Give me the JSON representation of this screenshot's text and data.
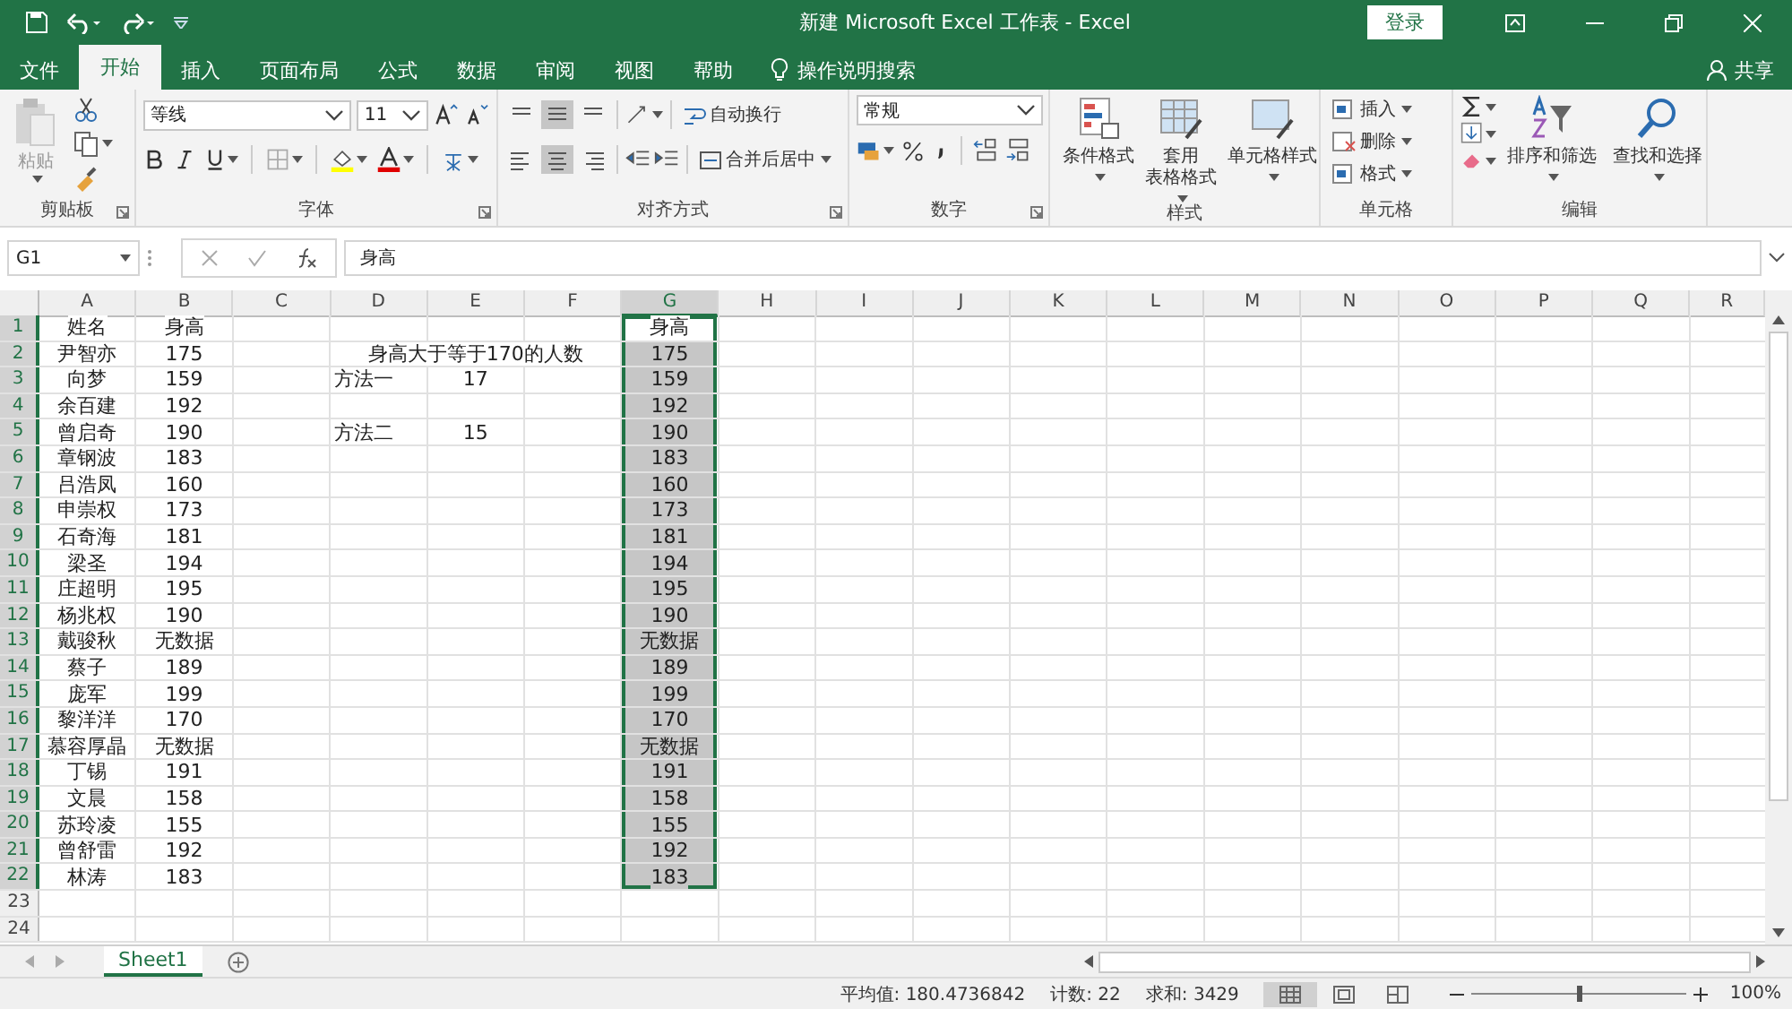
{
  "window": {
    "title": "新建 Microsoft Excel 工作表  -  Excel",
    "login": "登录"
  },
  "tabs": [
    {
      "label": "文件",
      "selected": false
    },
    {
      "label": "开始",
      "selected": true
    },
    {
      "label": "插入",
      "selected": false
    },
    {
      "label": "页面布局",
      "selected": false
    },
    {
      "label": "公式",
      "selected": false
    },
    {
      "label": "数据",
      "selected": false
    },
    {
      "label": "审阅",
      "selected": false
    },
    {
      "label": "视图",
      "selected": false
    },
    {
      "label": "帮助",
      "selected": false
    }
  ],
  "tell_me": {
    "placeholder": "操作说明搜索"
  },
  "share": "共享",
  "ribbon": {
    "clipboard": {
      "label": "剪贴板",
      "paste": "粘贴"
    },
    "font": {
      "label": "字体",
      "font_name": "等线",
      "font_size": "11"
    },
    "alignment": {
      "label": "对齐方式",
      "wrap": "自动换行",
      "merge": "合并后居中"
    },
    "number": {
      "label": "数字",
      "format": "常规"
    },
    "styles": {
      "label": "样式",
      "buttons": [
        [
          "条件格式"
        ],
        [
          "套用",
          "表格格式"
        ],
        [
          "单元格样式"
        ]
      ]
    },
    "cells": {
      "label": "单元格",
      "buttons": [
        "插入",
        "删除",
        "格式"
      ]
    },
    "editing": {
      "label": "编辑",
      "buttons": [
        "排序和筛选",
        "查找和选择"
      ]
    }
  },
  "name_box": "G1",
  "formula": "身高",
  "columns": [
    {
      "label": "A",
      "selected": false
    },
    {
      "label": "B",
      "selected": false
    },
    {
      "label": "C",
      "selected": false
    },
    {
      "label": "D",
      "selected": false
    },
    {
      "label": "E",
      "selected": false
    },
    {
      "label": "F",
      "selected": false
    },
    {
      "label": "G",
      "selected": true
    },
    {
      "label": "H",
      "selected": false
    },
    {
      "label": "I",
      "selected": false
    },
    {
      "label": "J",
      "selected": false
    },
    {
      "label": "K",
      "selected": false
    },
    {
      "label": "L",
      "selected": false
    },
    {
      "label": "M",
      "selected": false
    },
    {
      "label": "N",
      "selected": false
    },
    {
      "label": "O",
      "selected": false
    },
    {
      "label": "P",
      "selected": false
    },
    {
      "label": "Q",
      "selected": false
    },
    {
      "label": "R",
      "selected": false
    }
  ],
  "rows": [
    {
      "num": "1",
      "selected": true,
      "cells": {
        "a": "姓名",
        "b": "身高",
        "g": "身高"
      }
    },
    {
      "num": "2",
      "selected": true,
      "cells": {
        "a": "尹智亦",
        "b": "175",
        "e": "身高大于等于170的人数",
        "g": "175"
      }
    },
    {
      "num": "3",
      "selected": true,
      "cells": {
        "a": "向梦",
        "b": "159",
        "d": "方法一",
        "e": "17",
        "g": "159"
      }
    },
    {
      "num": "4",
      "selected": true,
      "cells": {
        "a": "余百建",
        "b": "192",
        "g": "192"
      }
    },
    {
      "num": "5",
      "selected": true,
      "cells": {
        "a": "曾启奇",
        "b": "190",
        "d": "方法二",
        "e": "15",
        "g": "190"
      }
    },
    {
      "num": "6",
      "selected": true,
      "cells": {
        "a": "章钢波",
        "b": "183",
        "g": "183"
      }
    },
    {
      "num": "7",
      "selected": true,
      "cells": {
        "a": "吕浩凤",
        "b": "160",
        "g": "160"
      }
    },
    {
      "num": "8",
      "selected": true,
      "cells": {
        "a": "申崇权",
        "b": "173",
        "g": "173"
      }
    },
    {
      "num": "9",
      "selected": true,
      "cells": {
        "a": "石奇海",
        "b": "181",
        "g": "181"
      }
    },
    {
      "num": "10",
      "selected": true,
      "cells": {
        "a": "梁圣",
        "b": "194",
        "g": "194"
      }
    },
    {
      "num": "11",
      "selected": true,
      "cells": {
        "a": "庄超明",
        "b": "195",
        "g": "195"
      }
    },
    {
      "num": "12",
      "selected": true,
      "cells": {
        "a": "杨兆权",
        "b": "190",
        "g": "190"
      }
    },
    {
      "num": "13",
      "selected": true,
      "cells": {
        "a": "戴骏秋",
        "b": "无数据",
        "g": "无数据"
      }
    },
    {
      "num": "14",
      "selected": true,
      "cells": {
        "a": "蔡子",
        "b": "189",
        "g": "189"
      }
    },
    {
      "num": "15",
      "selected": true,
      "cells": {
        "a": "庞军",
        "b": "199",
        "g": "199"
      }
    },
    {
      "num": "16",
      "selected": true,
      "cells": {
        "a": "黎洋洋",
        "b": "170",
        "g": "170"
      }
    },
    {
      "num": "17",
      "selected": true,
      "cells": {
        "a": "慕容厚晶",
        "b": "无数据",
        "g": "无数据"
      }
    },
    {
      "num": "18",
      "selected": true,
      "cells": {
        "a": "丁锡",
        "b": "191",
        "g": "191"
      }
    },
    {
      "num": "19",
      "selected": true,
      "cells": {
        "a": "文晨",
        "b": "158",
        "g": "158"
      }
    },
    {
      "num": "20",
      "selected": true,
      "cells": {
        "a": "苏玲凌",
        "b": "155",
        "g": "155"
      }
    },
    {
      "num": "21",
      "selected": true,
      "cells": {
        "a": "曾舒雷",
        "b": "192",
        "g": "192"
      }
    },
    {
      "num": "22",
      "selected": true,
      "cells": {
        "a": "林涛",
        "b": "183",
        "g": "183"
      }
    },
    {
      "num": "23",
      "selected": false,
      "cells": {}
    },
    {
      "num": "24",
      "selected": false,
      "cells": {}
    }
  ],
  "sheets": [
    {
      "label": "Sheet1",
      "selected": true
    }
  ],
  "status": {
    "average": "平均值: 180.4736842",
    "count": "计数: 22",
    "sum": "求和: 3429",
    "zoom": "100%",
    "level": 0.5
  }
}
